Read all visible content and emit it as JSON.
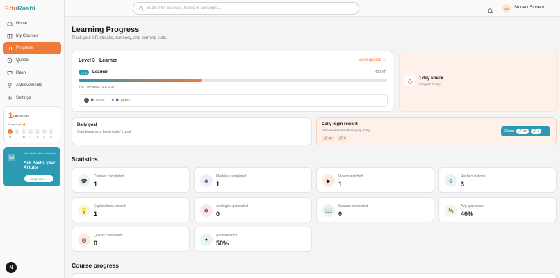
{
  "app": {
    "logo_part1": "Edu",
    "logo_part2": "Rashi"
  },
  "sidebar": {
    "items": [
      {
        "label": "Home",
        "icon": "home-icon",
        "active": false
      },
      {
        "label": "My Courses",
        "icon": "book-icon",
        "active": false
      },
      {
        "label": "Progress",
        "icon": "bar-chart-icon",
        "active": true
      },
      {
        "label": "Quests",
        "icon": "compass-icon",
        "active": false
      },
      {
        "label": "Rashi",
        "icon": "chat-icon",
        "active": false
      },
      {
        "label": "Achievements",
        "icon": "trophy-icon",
        "active": false
      },
      {
        "label": "Settings",
        "icon": "gear-icon",
        "active": false
      }
    ],
    "streak": {
      "count": "1",
      "label": "day streak",
      "keep": "Keep it up! 🔥",
      "days": [
        {
          "num": "✓",
          "letter": "M",
          "done": true
        },
        {
          "num": "0",
          "letter": "T",
          "done": false
        },
        {
          "num": "0",
          "letter": "W",
          "done": false
        },
        {
          "num": "0",
          "letter": "T",
          "done": false
        },
        {
          "num": "0",
          "letter": "F",
          "done": false
        },
        {
          "num": "0",
          "letter": "S",
          "done": false
        },
        {
          "num": "0",
          "letter": "S",
          "done": false
        }
      ]
    },
    "rashi_card": {
      "question": "Need help with a concept?",
      "title": "Ask Rashi, your AI tutor",
      "button": "Chat now →"
    },
    "badge": "N"
  },
  "header": {
    "search_placeholder": "Search for courses, topics or concepts...",
    "avatar_initials": "SS",
    "user_name": "Student Student"
  },
  "page": {
    "title": "Learning Progress",
    "subtitle": "Track your XP, streaks, currency, and learning stats."
  },
  "level": {
    "title": "Level 3 · Learner",
    "view_quests": "View quests →",
    "badge": "Lv 3",
    "name": "Learner",
    "xp_total": "420 XP",
    "progress_fraction": 0.4,
    "next_level": "120 / 300 XP to next level",
    "coins_value": "0",
    "coins_label": "coins",
    "gems_value": "0",
    "gems_label": "gems"
  },
  "streak_card": {
    "title": "1 day streak",
    "longest": "Longest: 1 days"
  },
  "daily_goal": {
    "title": "Daily goal",
    "subtitle": "Start learning to begin today's goal"
  },
  "daily_reward": {
    "title": "Daily login reward",
    "subtitle": "Earn rewards for showing up today",
    "chip1": "🔗 15",
    "chip2": "🔗 5",
    "claim": "Claim",
    "claim_chip1": "🔗 10",
    "claim_chip2": "🔗 5"
  },
  "statistics": {
    "heading": "Statistics",
    "items": [
      {
        "label": "Courses completed",
        "value": "1",
        "icon": "graduation-cap-icon",
        "glyph": "🎓",
        "bg": "#e6f4f7"
      },
      {
        "label": "Modules completed",
        "value": "1",
        "icon": "layers-icon",
        "glyph": "◈",
        "bg": "#f1ebfb"
      },
      {
        "label": "Videos watched",
        "value": "1",
        "icon": "video-icon",
        "glyph": "▶",
        "bg": "#fde9df"
      },
      {
        "label": "Rashi questions",
        "value": "3",
        "icon": "robot-icon",
        "glyph": "☺",
        "bg": "#e6f4f7"
      },
      {
        "label": "Explanations viewed",
        "value": "1",
        "icon": "lightbulb-icon",
        "glyph": "💡",
        "bg": "#fdf6dc"
      },
      {
        "label": "Analogies generated",
        "value": "0",
        "icon": "link-icon",
        "glyph": "✲",
        "bg": "#fde6ee"
      },
      {
        "label": "Quizzes completed",
        "value": "0",
        "icon": "open-book-icon",
        "glyph": "📖",
        "bg": "#e5f6ec"
      },
      {
        "label": "Avg quiz score",
        "value": "40%",
        "icon": "percent-icon",
        "glyph": "%",
        "bg": "#f4f7e0"
      },
      {
        "label": "Quests completed",
        "value": "0",
        "icon": "target-icon",
        "glyph": "◎",
        "bg": "#fde9df"
      },
      {
        "label": "AI confidence",
        "value": "50%",
        "icon": "sparkle-icon",
        "glyph": "✦",
        "bg": "#e5f6ec"
      }
    ]
  },
  "course_progress": {
    "heading": "Course progress"
  },
  "colors": {
    "accent": "#f07a3a",
    "brand": "#2b9ab2"
  }
}
